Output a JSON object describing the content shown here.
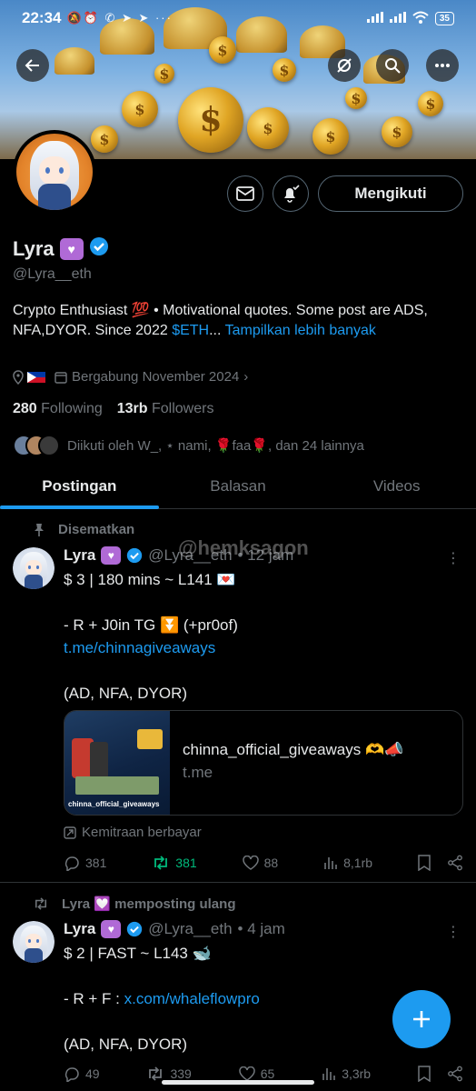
{
  "status_bar": {
    "time": "22:34",
    "left_icons": "🔕⏰ ✆ ➤ ➤ ···",
    "battery": "35"
  },
  "profile": {
    "name": "Lyra",
    "handle": "@Lyra__eth",
    "bio_text": "Crypto Enthusiast 💯 • Motivational quotes. Some post are ADS, NFA,DYOR. Since 2022 ",
    "bio_link": "$ETH",
    "bio_ellipsis": "...",
    "bio_more": "Tampilkan lebih banyak",
    "joined": "Bergabung November 2024",
    "following_count": "280",
    "following_label": "Following",
    "followers_count": "13rb",
    "followers_label": "Followers",
    "followed_by": "Diikuti oleh W_, ⋆ nami, 🌹faa🌹, dan 24 lainnya",
    "follow_button": "Mengikuti"
  },
  "tabs": [
    {
      "label": "Postingan",
      "active": true
    },
    {
      "label": "Balasan",
      "active": false
    },
    {
      "label": "Videos",
      "active": false
    }
  ],
  "watermark": "@hemksagon",
  "posts": [
    {
      "context": "Disematkan",
      "name": "Lyra",
      "handle": "@Lyra__eth",
      "time": "• 12 jam",
      "line1": "$ 3 | 180 mins ~ L141 💌",
      "line2": "- R + J0in TG ⏬ (+pr0of)",
      "link": "t.me/chinnagiveaways",
      "line3": "(AD, NFA, DYOR)",
      "card_title": "chinna_official_giveaways 🫶📣",
      "card_domain": "t.me",
      "card_img_label": "chinna_official_giveaways",
      "paid_label": "Kemitraan berbayar",
      "stats": {
        "replies": "381",
        "reposts": "381",
        "likes": "88",
        "views": "8,1rb"
      }
    },
    {
      "context": "Lyra 💟 memposting ulang",
      "name": "Lyra",
      "handle": "@Lyra__eth",
      "time": "• 4 jam",
      "line1": "$ 2 | FAST ~ L143 🐋",
      "line2_prefix": "- R + F : ",
      "link": "x.com/whaleflowpro",
      "line3": "(AD, NFA, DYOR)",
      "stats": {
        "replies": "49",
        "reposts": "339",
        "likes": "65",
        "views": "3,3rb"
      }
    }
  ],
  "colors": {
    "accent": "#1d9bf0",
    "repost_active": "#00ba7c",
    "badge": "#b06ad6"
  }
}
